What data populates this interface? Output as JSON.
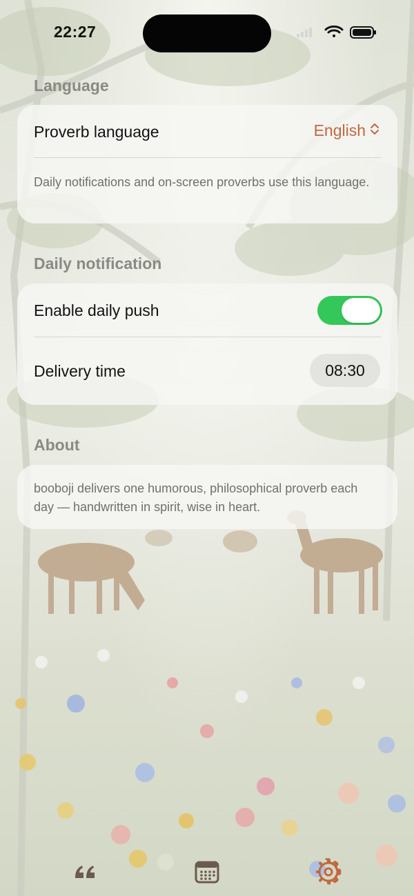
{
  "status_bar": {
    "time": "22:27"
  },
  "language_section": {
    "title": "Language",
    "row_label": "Proverb language",
    "value": "English",
    "note": "Daily notifications and on-screen proverbs use this language."
  },
  "notification_section": {
    "title": "Daily notification",
    "enable_label": "Enable daily push",
    "enabled": true,
    "time_label": "Delivery time",
    "time_value": "08:30"
  },
  "about_section": {
    "title": "About",
    "text": "booboji delivers one humorous, philosophical proverb each day — handwritten in spirit, wise in heart."
  },
  "tab_bar": {
    "tabs": [
      {
        "icon": "quote-icon",
        "active": false
      },
      {
        "icon": "calendar-icon",
        "active": false
      },
      {
        "icon": "gear-icon",
        "active": true
      }
    ]
  },
  "colors": {
    "accent": "#c0683f",
    "toggle_on": "#34c759",
    "tab_inactive": "#6b5a4e"
  }
}
